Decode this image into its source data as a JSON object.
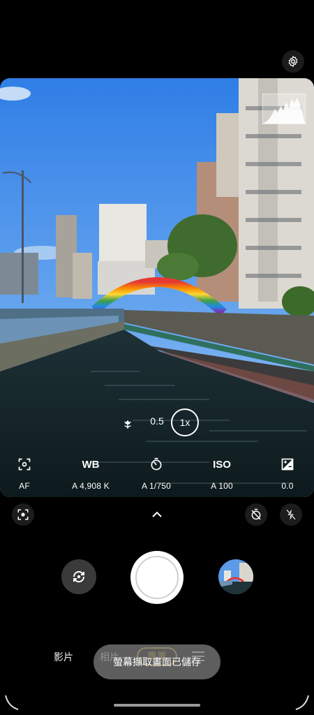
{
  "zoom": {
    "options": [
      "0.5",
      "1x"
    ],
    "selected": "1x"
  },
  "pro_controls": [
    {
      "id": "af",
      "icon": "focus-target-icon",
      "value": "AF"
    },
    {
      "id": "wb",
      "icon_text": "WB",
      "value": "A 4,908 K"
    },
    {
      "id": "shutter",
      "icon": "shutter-speed-icon",
      "value": "A 1/750"
    },
    {
      "id": "iso",
      "icon_text": "ISO",
      "value": "A 100"
    },
    {
      "id": "ev",
      "icon": "exposure-icon",
      "value": "0.0"
    }
  ],
  "modes": {
    "video": "影片",
    "photo": "相片",
    "pro": "專業"
  },
  "toast": "螢幕擷取畫面已儲存",
  "icons": {
    "settings": "gear-icon",
    "lens": "lens-icon",
    "expand": "chevron-up-icon",
    "timer": "timer-off-icon",
    "flash": "flash-off-icon",
    "flip": "camera-flip-icon",
    "menu": "hamburger-icon"
  },
  "colors": {
    "accent": "#e4b82e",
    "toast_bg": "#7a7a7a"
  }
}
